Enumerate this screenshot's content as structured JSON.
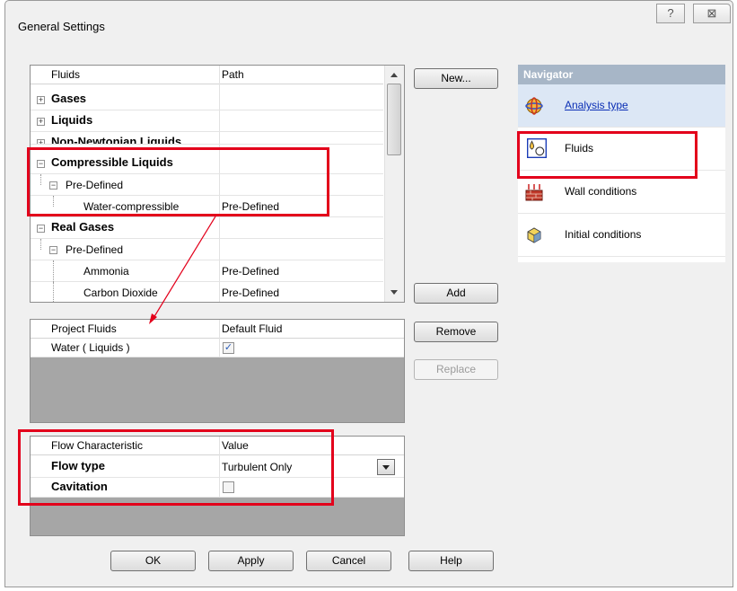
{
  "window": {
    "title": "General Settings",
    "help_glyph": "?",
    "close_glyph": "⊠"
  },
  "fluids_table": {
    "headers": {
      "fluids": "Fluids",
      "path": "Path"
    },
    "rows": [
      {
        "label": "Gases",
        "path": "",
        "toggle": "+"
      },
      {
        "label": "Liquids",
        "path": "",
        "toggle": "+"
      },
      {
        "label": "Non-Newtonian Liquids",
        "path": "",
        "toggle": "+"
      },
      {
        "label": "Compressible Liquids",
        "path": "",
        "toggle": "−"
      },
      {
        "label": "Pre-Defined",
        "path": "",
        "toggle": "−"
      },
      {
        "label": "Water-compressible",
        "path": "Pre-Defined"
      },
      {
        "label": "Real Gases",
        "path": "",
        "toggle": "−"
      },
      {
        "label": "Pre-Defined",
        "path": "",
        "toggle": "−"
      },
      {
        "label": "Ammonia",
        "path": "Pre-Defined"
      },
      {
        "label": "Carbon Dioxide",
        "path": "Pre-Defined"
      }
    ]
  },
  "project_fluids": {
    "headers": {
      "name": "Project Fluids",
      "default": "Default Fluid"
    },
    "rows": [
      {
        "name": "Water ( Liquids )",
        "default_checked": true
      }
    ]
  },
  "flow_table": {
    "headers": {
      "characteristic": "Flow Characteristic",
      "value": "Value"
    },
    "rows": [
      {
        "label": "Flow type",
        "value": "Turbulent Only"
      },
      {
        "label": "Cavitation",
        "value": ""
      }
    ]
  },
  "buttons": {
    "new": "New...",
    "add": "Add",
    "remove": "Remove",
    "replace": "Replace",
    "ok": "OK",
    "apply": "Apply",
    "cancel": "Cancel",
    "help": "Help"
  },
  "navigator": {
    "title": "Navigator",
    "items": [
      {
        "label": "Analysis type",
        "icon": "analysis-icon"
      },
      {
        "label": "Fluids",
        "icon": "fluids-icon"
      },
      {
        "label": "Wall conditions",
        "icon": "wall-icon"
      },
      {
        "label": "Initial conditions",
        "icon": "initial-icon"
      }
    ]
  },
  "colors": {
    "highlight": "#e3001b",
    "navigator_header": "#a7b6c7",
    "link": "#0b2fb5"
  }
}
